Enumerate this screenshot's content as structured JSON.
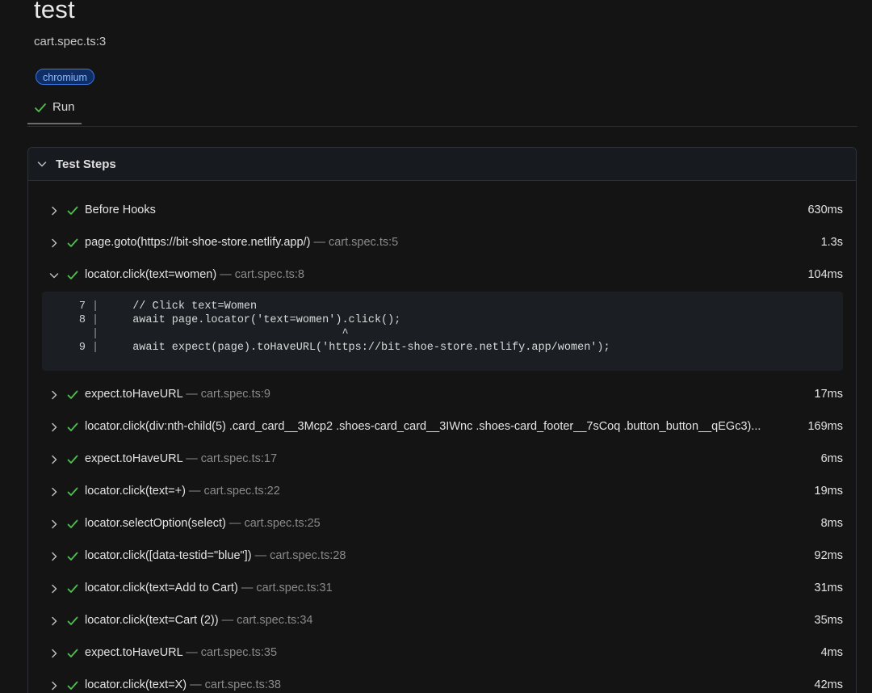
{
  "header": {
    "title": "test",
    "subtitle": "cart.spec.ts:3",
    "badge": "chromium"
  },
  "tab": {
    "label": "Run",
    "icon": "check-icon"
  },
  "panel": {
    "title": "Test Steps"
  },
  "colors": {
    "success": "#4fc04f",
    "badge_border": "#3a76e0",
    "badge_text": "#8fb8ff",
    "muted": "#8a8a8a"
  },
  "steps": [
    {
      "title": "Before Hooks",
      "location": "",
      "duration": "630ms",
      "expanded": false
    },
    {
      "title": "page.goto(https://bit-shoe-store.netlify.app/)",
      "location": "— cart.spec.ts:5",
      "duration": "1.3s",
      "expanded": false
    },
    {
      "title": "locator.click(text=women)",
      "location": "— cart.spec.ts:8",
      "duration": "104ms",
      "expanded": true
    },
    {
      "title": "expect.toHaveURL",
      "location": "— cart.spec.ts:9",
      "duration": "17ms",
      "expanded": false
    },
    {
      "title": "locator.click(div:nth-child(5) .card_card__3Mcp2 .shoes-card_card__3IWnc .shoes-card_footer__7sCoq .button_button__qEGc3)...",
      "location": "",
      "duration": "169ms",
      "expanded": false
    },
    {
      "title": "expect.toHaveURL",
      "location": "— cart.spec.ts:17",
      "duration": "6ms",
      "expanded": false
    },
    {
      "title": "locator.click(text=+)",
      "location": "— cart.spec.ts:22",
      "duration": "19ms",
      "expanded": false
    },
    {
      "title": "locator.selectOption(select)",
      "location": "— cart.spec.ts:25",
      "duration": "8ms",
      "expanded": false
    },
    {
      "title": "locator.click([data-testid=\"blue\"])",
      "location": "— cart.spec.ts:28",
      "duration": "92ms",
      "expanded": false
    },
    {
      "title": "locator.click(text=Add to Cart)",
      "location": "— cart.spec.ts:31",
      "duration": "31ms",
      "expanded": false
    },
    {
      "title": "locator.click(text=Cart (2))",
      "location": "— cart.spec.ts:34",
      "duration": "35ms",
      "expanded": false
    },
    {
      "title": "expect.toHaveURL",
      "location": "— cart.spec.ts:35",
      "duration": "4ms",
      "expanded": false
    },
    {
      "title": "locator.click(text=X)",
      "location": "— cart.spec.ts:38",
      "duration": "42ms",
      "expanded": false
    }
  ],
  "code": {
    "lines": [
      {
        "num": "7",
        "bar": "|",
        "src": "  // Click text=Women"
      },
      {
        "num": "8",
        "bar": "|",
        "src": "  await page.locator('text=women').click();"
      },
      {
        "num": "",
        "bar": "|",
        "src": "                                  ^"
      },
      {
        "num": "9",
        "bar": "|",
        "src": "  await expect(page).toHaveURL('https://bit-shoe-store.netlify.app/women');"
      }
    ]
  }
}
